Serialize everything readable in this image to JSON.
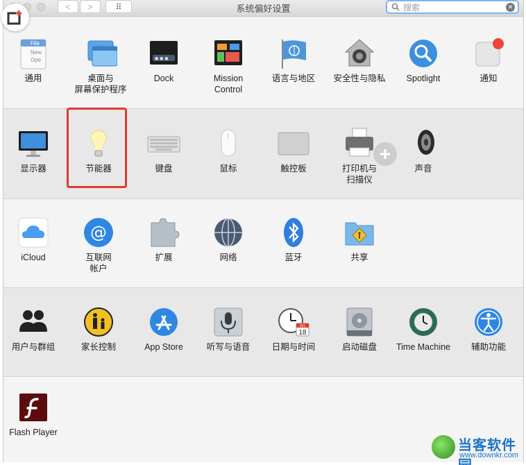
{
  "window": {
    "title": "系统偏好设置",
    "search_placeholder": "搜索",
    "nav_back": "<",
    "nav_forward": ">",
    "grid_glyph": "⠿"
  },
  "sections": [
    {
      "items": [
        {
          "label": "通用",
          "icon": "file-general-icon"
        },
        {
          "label": "桌面与\n屏幕保护程序",
          "icon": "desktop-screensaver-icon"
        },
        {
          "label": "Dock",
          "icon": "dock-icon"
        },
        {
          "label": "Mission\nControl",
          "icon": "mission-control-icon"
        },
        {
          "label": "语言与地区",
          "icon": "un-flag-icon"
        },
        {
          "label": "安全性与隐私",
          "icon": "security-house-icon"
        },
        {
          "label": "Spotlight",
          "icon": "spotlight-icon"
        },
        {
          "label": "通知",
          "icon": "notifications-icon"
        }
      ]
    },
    {
      "items": [
        {
          "label": "显示器",
          "icon": "display-icon"
        },
        {
          "label": "节能器",
          "icon": "lightbulb-icon"
        },
        {
          "label": "键盘",
          "icon": "keyboard-icon"
        },
        {
          "label": "鼠标",
          "icon": "mouse-icon"
        },
        {
          "label": "触控板",
          "icon": "trackpad-icon"
        },
        {
          "label": "打印机与\n扫描仪",
          "icon": "printer-icon"
        },
        {
          "label": "声音",
          "icon": "speaker-icon"
        }
      ]
    },
    {
      "items": [
        {
          "label": "iCloud",
          "icon": "icloud-icon"
        },
        {
          "label": "互联网\n帐户",
          "icon": "at-sign-icon"
        },
        {
          "label": "扩展",
          "icon": "puzzle-icon"
        },
        {
          "label": "网络",
          "icon": "globe-network-icon"
        },
        {
          "label": "蓝牙",
          "icon": "bluetooth-icon"
        },
        {
          "label": "共享",
          "icon": "sharing-folder-icon"
        }
      ]
    },
    {
      "items": [
        {
          "label": "用户与群组",
          "icon": "users-icon"
        },
        {
          "label": "家长控制",
          "icon": "parental-controls-icon"
        },
        {
          "label": "App Store",
          "icon": "app-store-icon"
        },
        {
          "label": "听写与语音",
          "icon": "microphone-icon"
        },
        {
          "label": "日期与时间",
          "icon": "clock-calendar-icon"
        },
        {
          "label": "启动磁盘",
          "icon": "disk-icon"
        },
        {
          "label": "Time Machine",
          "icon": "time-machine-icon"
        },
        {
          "label": "辅助功能",
          "icon": "accessibility-icon"
        }
      ]
    },
    {
      "items": [
        {
          "label": "Flash Player",
          "icon": "flash-icon"
        }
      ]
    }
  ],
  "icons": {
    "ical_day": "18",
    "ical_month": "JUL",
    "general_file_lines": [
      "File",
      "New",
      "Ope"
    ],
    "dock_dots": "● ● ●"
  },
  "watermark": {
    "title": "当客软件园",
    "url": "www.downkr.com"
  },
  "colors": {
    "highlight": "#e0392b",
    "search_border": "#7fb2ef"
  }
}
